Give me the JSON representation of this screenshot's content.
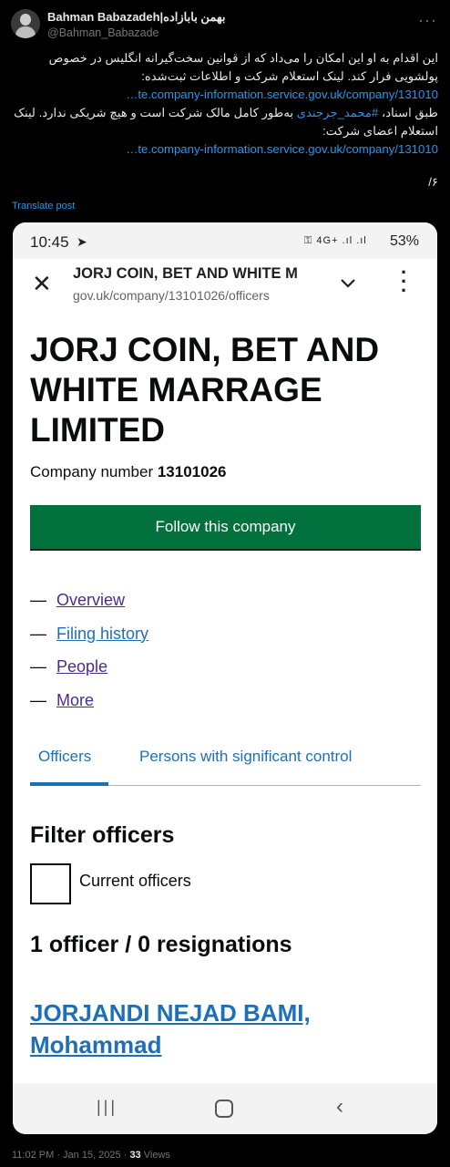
{
  "tweet": {
    "author_name": "Bahman Babazadeh|بهمن بابازاده",
    "handle": "@Bahman_Babazade",
    "more_icon": "more-icon",
    "paragraph1": "این اقدام به او این امکان را می‌داد که از قوانین سخت‌گیرانه انگلیس در خصوص پولشویی فرار کند. لینک استعلام شرکت و اطلاعات ثبت‌شده:",
    "link1": "…te.company-information.service.gov.uk/company/131010",
    "paragraph2_before": "طبق اسناد، ",
    "hashtag": "#محمد_جرجندی",
    "paragraph2_after": " به‌طور کامل مالک شرکت است و هیچ شریکی ندارد. لینک استعلام اعضای شرکت:",
    "link2": "…te.company-information.service.gov.uk/company/131010",
    "counter": "۶/",
    "translate": "Translate post",
    "time": "11:02 PM · Jan 15, 2025 · ",
    "views_count": "33",
    "views_label": " Views"
  },
  "screenshot": {
    "status": {
      "time": "10:45",
      "signals": "⚿ 4G+ .ıl .ıl",
      "battery": "53%"
    },
    "browser": {
      "title": "JORJ COIN, BET AND WHITE M",
      "url": "gov.uk/company/13101026/officers"
    },
    "company": {
      "name": "JORJ COIN, BET AND WHITE MARRAGE LIMITED",
      "number_label": "Company number ",
      "number": "13101026",
      "follow_button": "Follow this company"
    },
    "nav": {
      "overview": "Overview",
      "filing_history": "Filing history",
      "people": "People",
      "more": "More"
    },
    "tabs": {
      "officers": "Officers",
      "psc": "Persons with significant control"
    },
    "filter": {
      "title": "Filter officers",
      "checkbox_label": "Current officers"
    },
    "officers": {
      "count": "1 officer / 0 resignations",
      "name_line1": "JORJANDI NEJAD BAMI,",
      "name_line2": "Mohammad"
    }
  }
}
